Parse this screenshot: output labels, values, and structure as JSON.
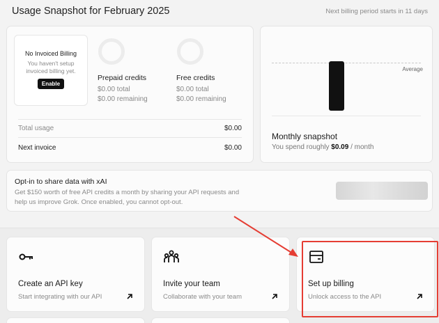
{
  "header": {
    "title": "Usage Snapshot for February 2025",
    "billing_note": "Next billing period starts in 11 days"
  },
  "invoice_box": {
    "title": "No Invoiced Billing",
    "subtitle": "You haven't setup invoiced billing yet.",
    "enable_label": "Enable"
  },
  "credits": {
    "prepaid": {
      "title": "Prepaid credits",
      "total": "$0.00 total",
      "remaining": "$0.00 remaining"
    },
    "free": {
      "title": "Free credits",
      "total": "$0.00 total",
      "remaining": "$0.00 remaining"
    }
  },
  "summary": {
    "total_usage_label": "Total usage",
    "total_usage_value": "$0.00",
    "next_invoice_label": "Next invoice",
    "next_invoice_value": "$0.00"
  },
  "snapshot": {
    "average_label": "Average",
    "title": "Monthly snapshot",
    "sub_prefix": "You spend roughly",
    "amount": "$0.09",
    "sub_suffix": "/ month"
  },
  "chart_data": {
    "type": "bar",
    "categories": [
      ""
    ],
    "values": [
      0.09
    ],
    "average": 0.09,
    "ylim": [
      0,
      0.12
    ]
  },
  "optin": {
    "title": "Opt-in to share data with xAI",
    "line1": "Get $150 worth of free API credits a month by sharing your API requests and",
    "line2": "help us improve Grok. Once enabled, you cannot opt-out."
  },
  "actions": [
    {
      "title": "Create an API key",
      "subtitle": "Start integrating with our API",
      "icon": "key-icon"
    },
    {
      "title": "Invite your team",
      "subtitle": "Collaborate with your team",
      "icon": "team-icon"
    },
    {
      "title": "Set up billing",
      "subtitle": "Unlock access to the API",
      "icon": "billing-icon"
    }
  ],
  "colors": {
    "highlight": "#e53d33",
    "accent_dark": "#111111"
  }
}
